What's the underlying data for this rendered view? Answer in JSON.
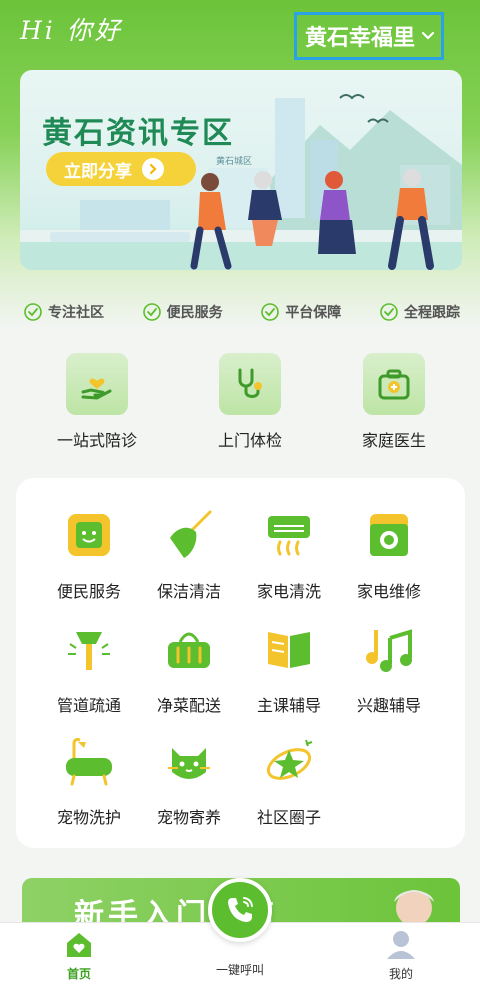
{
  "header": {
    "greeting": "Hi 你好",
    "location": "黄石幸福里"
  },
  "banner": {
    "title": "黄石资讯专区",
    "button": "立即分享",
    "sign_text": "黄石城区"
  },
  "features": [
    "专注社区",
    "便民服务",
    "平台保障",
    "全程跟踪"
  ],
  "top_services": [
    "一站式陪诊",
    "上门体检",
    "家庭医生"
  ],
  "grid_services": [
    {
      "label": "便民服务",
      "icon": "face-scan-icon"
    },
    {
      "label": "保洁清洁",
      "icon": "broom-icon"
    },
    {
      "label": "家电清洗",
      "icon": "air-conditioner-icon"
    },
    {
      "label": "家电维修",
      "icon": "washing-machine-icon"
    },
    {
      "label": "管道疏通",
      "icon": "plunger-icon"
    },
    {
      "label": "净菜配送",
      "icon": "basket-icon"
    },
    {
      "label": "主课辅导",
      "icon": "book-icon"
    },
    {
      "label": "兴趣辅导",
      "icon": "music-note-icon"
    },
    {
      "label": "宠物洗护",
      "icon": "bathtub-icon"
    },
    {
      "label": "宠物寄养",
      "icon": "cat-icon"
    },
    {
      "label": "社区圈子",
      "icon": "planet-star-icon"
    }
  ],
  "guide": {
    "title": "新手入门指南"
  },
  "bottom_nav": {
    "home": "首页",
    "call": "一键呼叫",
    "mine": "我的"
  },
  "colors": {
    "brand_green": "#5cbd2e",
    "highlight_border": "#2aa3e6",
    "banner_yellow": "#f6d23a"
  }
}
